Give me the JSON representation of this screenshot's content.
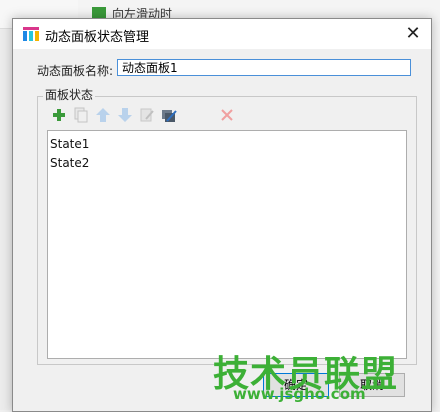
{
  "background": {
    "item_label": "向左滑动时"
  },
  "dialog": {
    "title": "动态面板状态管理",
    "close_glyph": "✕"
  },
  "form": {
    "name_label": "动态面板名称:",
    "name_value": "动态面板1"
  },
  "group": {
    "label": "面板状态"
  },
  "toolbar": {
    "icons": [
      "add-icon",
      "duplicate-icon",
      "move-up-icon",
      "move-down-icon",
      "edit-icon",
      "edit-all-icon",
      "delete-icon"
    ],
    "add_color": "#3a9a3a",
    "delete_color": "#f0a0a0"
  },
  "states": [
    "State1",
    "State2"
  ],
  "buttons": {
    "ok": "确定",
    "cancel": "取消"
  },
  "watermark": {
    "title": "技术员联盟",
    "url": "www.jsgho.com"
  }
}
